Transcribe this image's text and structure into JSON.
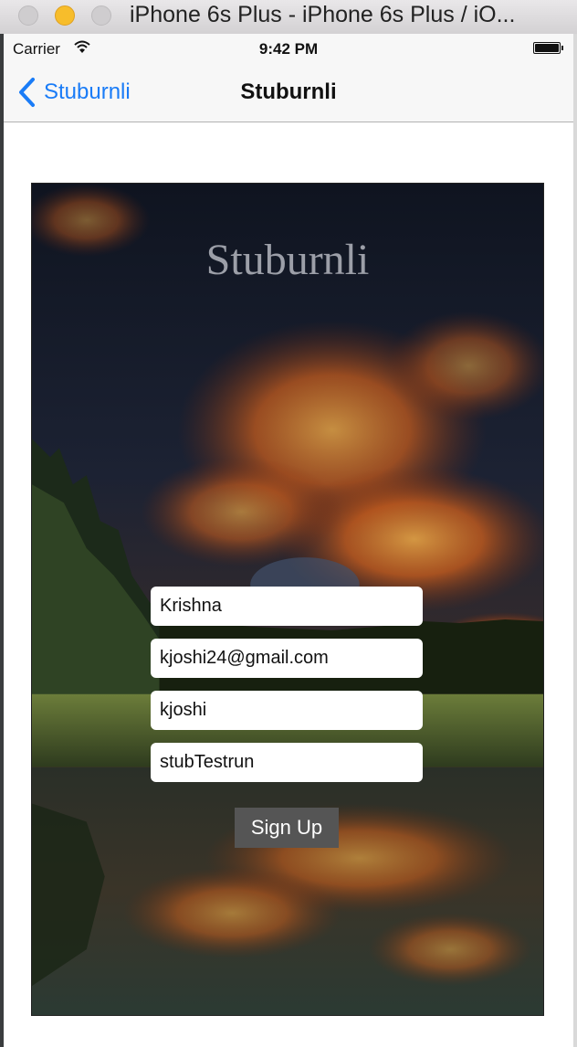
{
  "window": {
    "title": "iPhone 6s Plus - iPhone 6s Plus / iO..."
  },
  "status_bar": {
    "carrier": "Carrier",
    "time": "9:42 PM"
  },
  "nav": {
    "back_label": "Stuburnli",
    "title": "Stuburnli"
  },
  "app": {
    "title": "Stuburnli"
  },
  "form": {
    "name": "Krishna",
    "email": "kjoshi24@gmail.com",
    "username": "kjoshi",
    "password": "stubTestrun",
    "signup_label": "Sign Up"
  },
  "colors": {
    "accent": "#1a7cf7",
    "button": "#555555"
  }
}
